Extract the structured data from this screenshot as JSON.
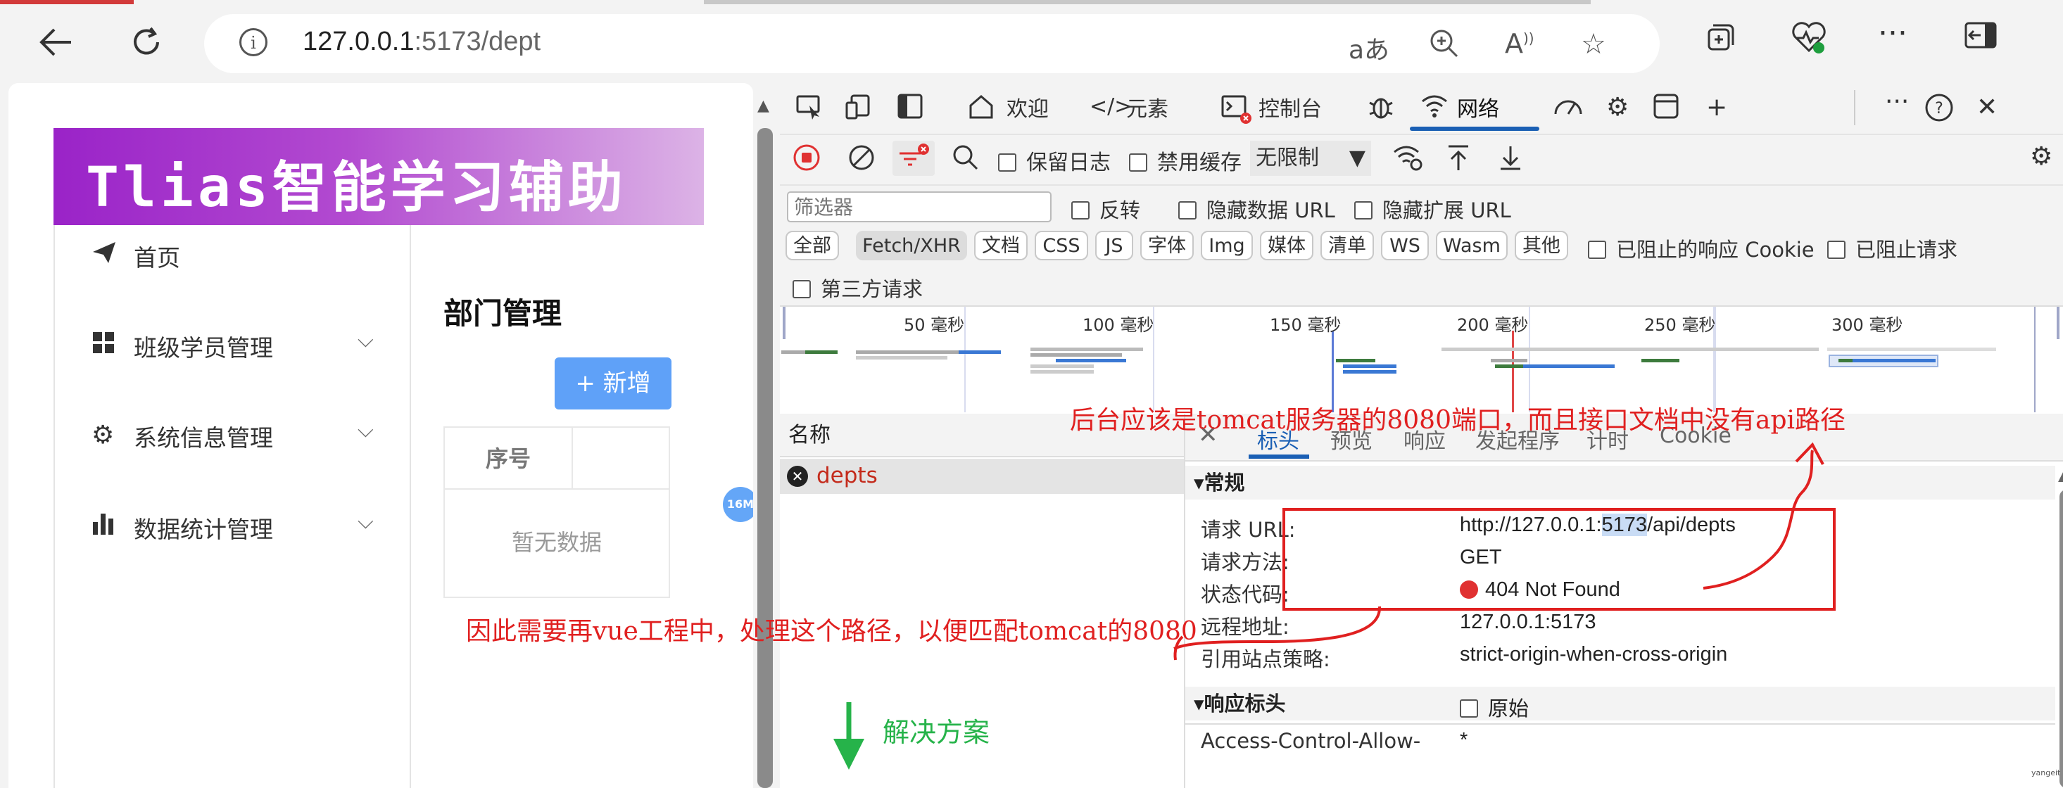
{
  "browser": {
    "address": {
      "host": "127.0.0.1",
      "port_path": ":5173/dept"
    },
    "icons": [
      "back-arrow-icon",
      "refresh-icon",
      "info-icon",
      "read-aloud-icon",
      "zoom-icon",
      "text-icon",
      "favorite-star-icon",
      "collections-icon",
      "browser-health-icon",
      "more-icon",
      "sidebar-toggle-icon"
    ]
  },
  "page": {
    "banner_title": "Tlias智能学习辅助",
    "menu": [
      {
        "icon": "send-icon",
        "label": "首页"
      },
      {
        "icon": "grid-icon",
        "label": "班级学员管理"
      },
      {
        "icon": "gear-icon",
        "label": "系统信息管理"
      },
      {
        "icon": "bar-chart-icon",
        "label": "数据统计管理"
      }
    ],
    "title": "部门管理",
    "add_button": "+ 新增",
    "table": {
      "col1": "序号",
      "empty": "暂无数据"
    },
    "perf_badge": "16M"
  },
  "devtools": {
    "tabs": [
      "欢迎",
      "元素",
      "控制台",
      "网络"
    ],
    "toolbar": {
      "preserve_log": "保留日志",
      "disable_cache": "禁用缓存",
      "throttle": "无限制"
    },
    "filter": {
      "placeholder": "筛选器",
      "invert": "反转",
      "hide_data_url": "隐藏数据 URL",
      "hide_ext_url": "隐藏扩展 URL",
      "types": [
        "全部",
        "Fetch/XHR",
        "文档",
        "CSS",
        "JS",
        "字体",
        "Img",
        "媒体",
        "清单",
        "WS",
        "Wasm",
        "其他"
      ],
      "blocked_cookie": "已阻止的响应 Cookie",
      "blocked_req": "已阻止请求",
      "third_party": "第三方请求"
    },
    "timeline_ticks": [
      "50 毫秒",
      "100 毫秒",
      "150 毫秒",
      "200 毫秒",
      "250 毫秒",
      "300 毫秒"
    ],
    "names_header": "名称",
    "request_name": "depts",
    "detail_tabs": [
      "标头",
      "预览",
      "响应",
      "发起程序",
      "计时",
      "Cookie"
    ],
    "general_title": "▾常规",
    "general": [
      {
        "k": "请求 URL:",
        "v_pre": "http://127.0.0.1:",
        "v_hl": "5173",
        "v_post": "/api/depts"
      },
      {
        "k": "请求方法:",
        "v": "GET"
      },
      {
        "k": "状态代码:",
        "v": "404 Not Found"
      },
      {
        "k": "远程地址:",
        "v": "127.0.0.1:5173"
      },
      {
        "k": "引用站点策略:",
        "v": "strict-origin-when-cross-origin"
      }
    ],
    "response_headers_title": "▾响应标头",
    "raw_label": "原始",
    "acao_key": "Access-Control-Allow-",
    "acao_val": "*"
  },
  "annotations": {
    "top": "后台应该是tomcat服务器的8080端口，而且接口文档中没有api路径",
    "left": "因此需要再vue工程中，处理这个路径，以便匹配tomcat的8080",
    "solution": "解决方案",
    "colors": {
      "red": "#e02020",
      "green": "#26b34a"
    }
  },
  "watermark": "yangeit"
}
